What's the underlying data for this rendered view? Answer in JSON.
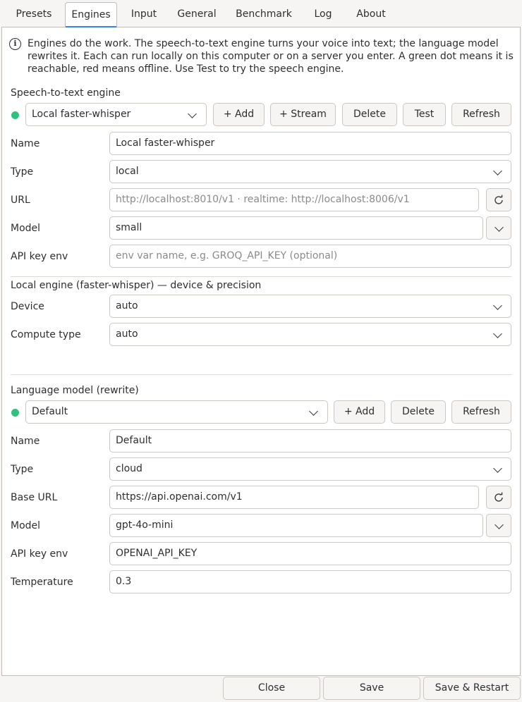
{
  "tabs": [
    "Presets",
    "Engines",
    "Input",
    "General",
    "Benchmark",
    "Log",
    "About"
  ],
  "intro": "Engines do the work. The speech-to-text engine turns your voice into text; the language model rewrites it. Each can run locally on this computer or on a server you enter. A green dot means it is reachable, red means offline. Use Test to try the speech engine.",
  "stt": {
    "title": "Speech-to-text engine",
    "status_color": "#2ec27e",
    "selected": "Local faster-whisper",
    "add_label": "+ Add",
    "stream_label": "+ Stream",
    "delete_label": "Delete",
    "test_label": "Test",
    "refresh_label": "Refresh",
    "name_label": "Name",
    "name_value": "Local faster-whisper",
    "type_label": "Type",
    "type_value": "local",
    "url_label": "URL",
    "url_placeholder": "http://localhost:8010/v1  ·  realtime: http://localhost:8006/v1",
    "model_label": "Model",
    "model_value": "small",
    "apikey_label": "API key env",
    "apikey_placeholder": "env var name, e.g. GROQ_API_KEY  (optional)"
  },
  "local_engine": {
    "title": "Local engine (faster-whisper) — device & precision",
    "device_label": "Device",
    "device_value": "auto",
    "compute_label": "Compute type",
    "compute_value": "auto"
  },
  "llm": {
    "title": "Language model (rewrite)",
    "status_color": "#2ec27e",
    "selected": "Default",
    "add_label": "+ Add",
    "delete_label": "Delete",
    "refresh_label": "Refresh",
    "name_label": "Name",
    "name_value": "Default",
    "type_label": "Type",
    "type_value": "cloud",
    "baseurl_label": "Base URL",
    "baseurl_value": "https://api.openai.com/v1",
    "model_label": "Model",
    "model_value": "gpt-4o-mini",
    "apikey_label": "API key env",
    "apikey_value": "OPENAI_API_KEY",
    "temperature_label": "Temperature",
    "temperature_value": "0.3"
  },
  "footer": {
    "close_label": "Close",
    "save_label": "Save",
    "save_restart_label": "Save & Restart"
  },
  "icons": {
    "info": "info-icon",
    "chevron": "chevron-down-icon",
    "refresh": "refresh-icon"
  }
}
